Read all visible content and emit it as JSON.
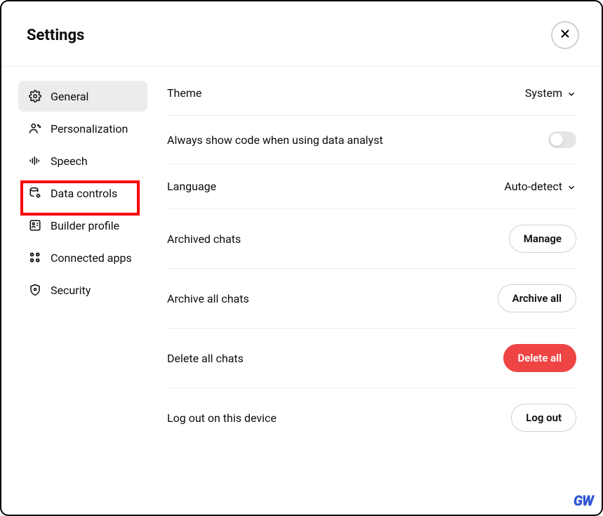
{
  "header": {
    "title": "Settings"
  },
  "sidebar": {
    "items": [
      {
        "label": "General"
      },
      {
        "label": "Personalization"
      },
      {
        "label": "Speech"
      },
      {
        "label": "Data controls"
      },
      {
        "label": "Builder profile"
      },
      {
        "label": "Connected apps"
      },
      {
        "label": "Security"
      }
    ]
  },
  "main": {
    "theme": {
      "label": "Theme",
      "value": "System"
    },
    "always_code": {
      "label": "Always show code when using data analyst",
      "enabled": false
    },
    "language": {
      "label": "Language",
      "value": "Auto-detect"
    },
    "archived": {
      "label": "Archived chats",
      "button": "Manage"
    },
    "archive_all": {
      "label": "Archive all chats",
      "button": "Archive all"
    },
    "delete_all": {
      "label": "Delete all chats",
      "button": "Delete all"
    },
    "logout": {
      "label": "Log out on this device",
      "button": "Log out"
    }
  },
  "watermark": "GW"
}
